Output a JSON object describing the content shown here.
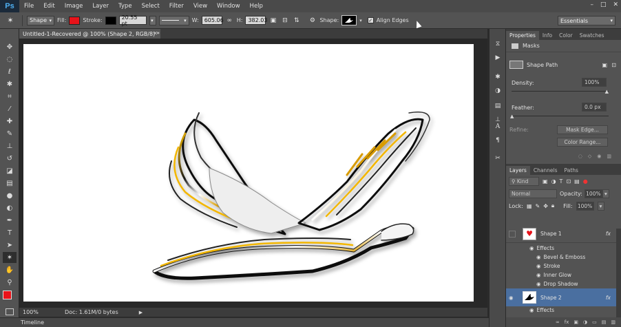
{
  "app": {
    "logo": "Ps"
  },
  "menu": [
    "File",
    "Edit",
    "Image",
    "Layer",
    "Type",
    "Select",
    "Filter",
    "View",
    "Window",
    "Help"
  ],
  "window_controls": [
    "–",
    "□",
    "✕"
  ],
  "options": {
    "mode": "Shape",
    "fill_label": "Fill:",
    "stroke_label": "Stroke:",
    "stroke_width": "20.55 pt",
    "w_label": "W:",
    "w_value": "605.06",
    "h_label": "H:",
    "h_value": "382.03",
    "shape_label": "Shape:",
    "align_label": "Align Edges",
    "align_checked": true,
    "workspace": "Essentials",
    "fill_color": "#e8131a",
    "stroke_color": "#000000"
  },
  "document": {
    "tab": "Untitled-1-Recovered @ 100% (Shape 2, RGB/8) *"
  },
  "status": {
    "zoom": "100%",
    "doc": "Doc: 1.61M/0 bytes"
  },
  "timeline": "Timeline",
  "properties": {
    "tabs": [
      "Properties",
      "Info",
      "Color",
      "Swatches"
    ],
    "section": "Masks",
    "path_label": "Shape Path",
    "density_label": "Density:",
    "density": "100%",
    "feather_label": "Feather:",
    "feather": "0.0 px",
    "refine_label": "Refine:",
    "mask_edge": "Mask Edge...",
    "color_range": "Color Range..."
  },
  "layers": {
    "tabs": [
      "Layers",
      "Channels",
      "Paths"
    ],
    "kind": "Kind",
    "blend": "Normal",
    "opacity_label": "Opacity:",
    "opacity": "100%",
    "lock_label": "Lock:",
    "fill_label": "Fill:",
    "fill": "100%",
    "items": [
      {
        "name": "Shape 1",
        "fx": "fx",
        "effects_label": "Effects",
        "effects": [
          "Bevel & Emboss",
          "Stroke",
          "Inner Glow",
          "Drop Shadow"
        ]
      },
      {
        "name": "Shape 2",
        "fx": "fx",
        "effects_label": "Effects"
      }
    ]
  },
  "accent": "#4a6fa0",
  "icons": {
    "tools": [
      "move-icon",
      "marquee-icon",
      "lasso-icon",
      "magic-wand-icon",
      "crop-icon",
      "eyedropper-icon",
      "healing-icon",
      "brush-icon",
      "clone-stamp-icon",
      "history-brush-icon",
      "eraser-icon",
      "gradient-icon",
      "blur-icon",
      "dodge-icon",
      "pen-icon",
      "type-icon",
      "path-selection-icon",
      "custom-shape-icon",
      "hand-icon",
      "zoom-icon"
    ]
  }
}
